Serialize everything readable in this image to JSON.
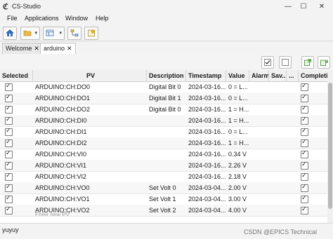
{
  "window": {
    "title": "CS-Studio",
    "icon": "cs-studio-logo",
    "controls": [
      "—",
      "☐",
      "✕"
    ]
  },
  "menu": [
    "File",
    "Applications",
    "Window",
    "Help"
  ],
  "toolbar": {
    "buttons": [
      "home-icon",
      "folder-icon",
      "layout-icon",
      "connect-icon",
      "new-window-icon"
    ]
  },
  "tabs": [
    {
      "label": "Welcome",
      "close": "✕",
      "active": false
    },
    {
      "label": "arduino",
      "close": "✕",
      "active": true
    }
  ],
  "view_toolbar": {
    "buttons": [
      "check-all-icon",
      "uncheck-all-icon",
      "restore-icon",
      "save-icon"
    ]
  },
  "table": {
    "columns": [
      "Selected",
      "PV",
      "Description",
      "Timestamp",
      "Value",
      "Alarm",
      "Sav...",
      "...",
      "Completion"
    ],
    "rows": [
      {
        "pv": "ARDUINO:CH:DO0",
        "description": "Digital Bit 0",
        "timestamp": "2024-03-16...",
        "value": "0 = L..."
      },
      {
        "pv": "ARDUINO:CH:DO1",
        "description": "Digital Bit 1",
        "timestamp": "2024-03-16...",
        "value": "0 = L..."
      },
      {
        "pv": "ARDUINO:CH:DO2",
        "description": "Digital Bit 0",
        "timestamp": "2024-03-16...",
        "value": "1 = H..."
      },
      {
        "pv": "ARDUINO:CH:DI0",
        "description": "",
        "timestamp": "2024-03-16...",
        "value": "1 = H..."
      },
      {
        "pv": "ARDUINO:CH:DI1",
        "description": "",
        "timestamp": "2024-03-16...",
        "value": "0 = L..."
      },
      {
        "pv": "ARDUINO:CH:DI2",
        "description": "",
        "timestamp": "2024-03-16...",
        "value": "1 = H..."
      },
      {
        "pv": "ARDUINO:CH:VI0",
        "description": "",
        "timestamp": "2024-03-16...",
        "value": "0.34 V"
      },
      {
        "pv": "ARDUINO:CH:VI1",
        "description": "",
        "timestamp": "2024-03-16...",
        "value": "2.26 V"
      },
      {
        "pv": "ARDUINO:CH:VI2",
        "description": "",
        "timestamp": "2024-03-16...",
        "value": "2.18 V"
      },
      {
        "pv": "ARDUINO:CH:VO0",
        "description": "Set Volt 0",
        "timestamp": "2024-03-04...",
        "value": "2.00 V"
      },
      {
        "pv": "ARDUINO:CH:VO1",
        "description": "Set Volt 1",
        "timestamp": "2024-03-04...",
        "value": "3.00 V"
      },
      {
        "pv": "ARDUINO:CH:VO2",
        "description": "Set Volt 2",
        "timestamp": "2024-03-04...",
        "value": "4.00 V"
      }
    ],
    "placeholder": "Enter new PV"
  },
  "status": {
    "text": "yuyuy"
  },
  "watermark": "CSDN @EPICS Technical"
}
